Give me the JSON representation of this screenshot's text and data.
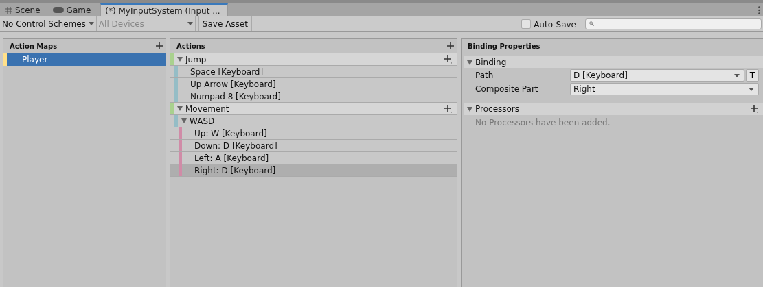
{
  "tabs": [
    {
      "label": "Scene",
      "selected": false
    },
    {
      "label": "Game",
      "selected": false
    },
    {
      "label": "(*) MyInputSystem (Input ...",
      "selected": true
    }
  ],
  "toolbar": {
    "control_schemes": "No Control Schemes",
    "devices": "All Devices",
    "devices_disabled": true,
    "save_button": "Save Asset",
    "auto_save": {
      "label": "Auto-Save",
      "checked": false
    }
  },
  "action_maps": {
    "title": "Action Maps",
    "items": [
      {
        "label": "Player",
        "selected": true
      }
    ]
  },
  "actions": {
    "title": "Actions",
    "items": [
      {
        "kind": "action",
        "label": "Jump",
        "expanded": true,
        "selected": false
      },
      {
        "kind": "binding",
        "label": "Space [Keyboard]",
        "selected": false
      },
      {
        "kind": "binding",
        "label": "Up Arrow [Keyboard]",
        "selected": false
      },
      {
        "kind": "binding",
        "label": "Numpad 8 [Keyboard]",
        "selected": false
      },
      {
        "kind": "action",
        "label": "Movement",
        "expanded": true,
        "selected": false
      },
      {
        "kind": "composite",
        "label": "WASD",
        "expanded": true,
        "selected": false
      },
      {
        "kind": "part",
        "label": "Up: W [Keyboard]",
        "selected": false
      },
      {
        "kind": "part",
        "label": "Down: D [Keyboard]",
        "selected": false
      },
      {
        "kind": "part",
        "label": "Left: A [Keyboard]",
        "selected": false
      },
      {
        "kind": "part",
        "label": "Right: D [Keyboard]",
        "selected": true
      }
    ]
  },
  "binding_properties": {
    "title": "Binding Properties",
    "binding": {
      "title": "Binding",
      "expanded": true,
      "path_label": "Path",
      "path_value": "D [Keyboard]",
      "t_button": "T",
      "part_label": "Composite Part",
      "part_value": "Right"
    },
    "processors": {
      "title": "Processors",
      "expanded": true,
      "empty_text": "No Processors have been added."
    }
  }
}
